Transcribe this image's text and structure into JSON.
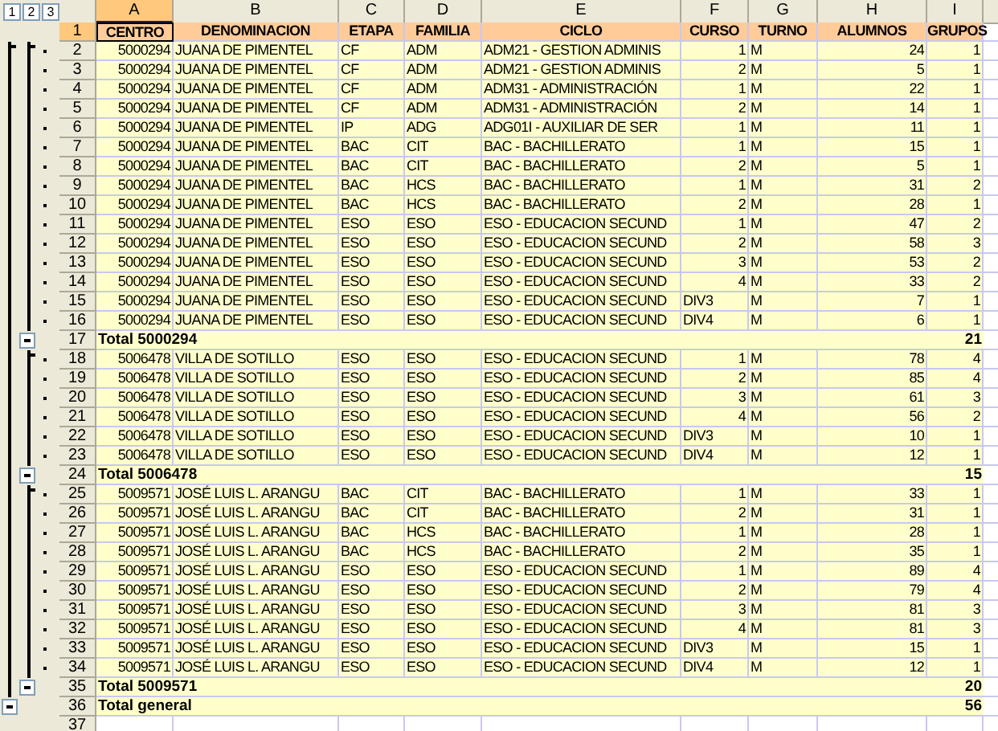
{
  "outline_levels": [
    "1",
    "2",
    "3"
  ],
  "columns": [
    {
      "letter": "A",
      "selected": true
    },
    {
      "letter": "B",
      "selected": false
    },
    {
      "letter": "C",
      "selected": false
    },
    {
      "letter": "D",
      "selected": false
    },
    {
      "letter": "E",
      "selected": false
    },
    {
      "letter": "F",
      "selected": false
    },
    {
      "letter": "G",
      "selected": false
    },
    {
      "letter": "H",
      "selected": false
    },
    {
      "letter": "I",
      "selected": false
    }
  ],
  "rows": [
    {
      "num": "1",
      "kind": "header",
      "selected": true,
      "cells": [
        "CENTRO",
        "DENOMINACION",
        "ETAPA",
        "FAMILIA",
        "CICLO",
        "CURSO",
        "TURNO",
        "ALUMNOS",
        "GRUPOS"
      ]
    },
    {
      "num": "2",
      "kind": "detail",
      "selected": false,
      "cells": [
        "5000294",
        "JUANA DE PIMENTEL",
        "CF",
        "ADM",
        "ADM21 - GESTION ADMINIS",
        "1",
        "M",
        "24",
        "1"
      ]
    },
    {
      "num": "3",
      "kind": "detail",
      "selected": false,
      "cells": [
        "5000294",
        "JUANA DE PIMENTEL",
        "CF",
        "ADM",
        "ADM21 - GESTION ADMINIS",
        "2",
        "M",
        "5",
        "1"
      ]
    },
    {
      "num": "4",
      "kind": "detail",
      "selected": false,
      "cells": [
        "5000294",
        "JUANA DE PIMENTEL",
        "CF",
        "ADM",
        "ADM31 - ADMINISTRACIÓN",
        "1",
        "M",
        "22",
        "1"
      ]
    },
    {
      "num": "5",
      "kind": "detail",
      "selected": false,
      "cells": [
        "5000294",
        "JUANA DE PIMENTEL",
        "CF",
        "ADM",
        "ADM31 - ADMINISTRACIÓN",
        "2",
        "M",
        "14",
        "1"
      ]
    },
    {
      "num": "6",
      "kind": "detail",
      "selected": false,
      "cells": [
        "5000294",
        "JUANA DE PIMENTEL",
        "IP",
        "ADG",
        "ADG01I - AUXILIAR DE SER",
        "1",
        "M",
        "11",
        "1"
      ]
    },
    {
      "num": "7",
      "kind": "detail",
      "selected": false,
      "cells": [
        "5000294",
        "JUANA DE PIMENTEL",
        "BAC",
        "CIT",
        "BAC - BACHILLERATO",
        "1",
        "M",
        "15",
        "1"
      ]
    },
    {
      "num": "8",
      "kind": "detail",
      "selected": false,
      "cells": [
        "5000294",
        "JUANA DE PIMENTEL",
        "BAC",
        "CIT",
        "BAC - BACHILLERATO",
        "2",
        "M",
        "5",
        "1"
      ]
    },
    {
      "num": "9",
      "kind": "detail",
      "selected": false,
      "cells": [
        "5000294",
        "JUANA DE PIMENTEL",
        "BAC",
        "HCS",
        "BAC - BACHILLERATO",
        "1",
        "M",
        "31",
        "2"
      ]
    },
    {
      "num": "10",
      "kind": "detail",
      "selected": false,
      "cells": [
        "5000294",
        "JUANA DE PIMENTEL",
        "BAC",
        "HCS",
        "BAC - BACHILLERATO",
        "2",
        "M",
        "28",
        "1"
      ]
    },
    {
      "num": "11",
      "kind": "detail",
      "selected": false,
      "cells": [
        "5000294",
        "JUANA DE PIMENTEL",
        "ESO",
        "ESO",
        "ESO - EDUCACION SECUND",
        "1",
        "M",
        "47",
        "2"
      ]
    },
    {
      "num": "12",
      "kind": "detail",
      "selected": false,
      "cells": [
        "5000294",
        "JUANA DE PIMENTEL",
        "ESO",
        "ESO",
        "ESO - EDUCACION SECUND",
        "2",
        "M",
        "58",
        "3"
      ]
    },
    {
      "num": "13",
      "kind": "detail",
      "selected": false,
      "cells": [
        "5000294",
        "JUANA DE PIMENTEL",
        "ESO",
        "ESO",
        "ESO - EDUCACION SECUND",
        "3",
        "M",
        "53",
        "2"
      ]
    },
    {
      "num": "14",
      "kind": "detail",
      "selected": false,
      "cells": [
        "5000294",
        "JUANA DE PIMENTEL",
        "ESO",
        "ESO",
        "ESO - EDUCACION SECUND",
        "4",
        "M",
        "33",
        "2"
      ]
    },
    {
      "num": "15",
      "kind": "detail",
      "selected": false,
      "cells": [
        "5000294",
        "JUANA DE PIMENTEL",
        "ESO",
        "ESO",
        "ESO - EDUCACION SECUND",
        "DIV3",
        "M",
        "7",
        "1"
      ]
    },
    {
      "num": "16",
      "kind": "detail",
      "selected": false,
      "cells": [
        "5000294",
        "JUANA DE PIMENTEL",
        "ESO",
        "ESO",
        "ESO - EDUCACION SECUND",
        "DIV4",
        "M",
        "6",
        "1"
      ]
    },
    {
      "num": "17",
      "kind": "subtotal",
      "selected": false,
      "label": "Total 5000294",
      "total": "21"
    },
    {
      "num": "18",
      "kind": "detail",
      "selected": false,
      "cells": [
        "5006478",
        "VILLA DE SOTILLO",
        "ESO",
        "ESO",
        "ESO - EDUCACION SECUND",
        "1",
        "M",
        "78",
        "4"
      ]
    },
    {
      "num": "19",
      "kind": "detail",
      "selected": false,
      "cells": [
        "5006478",
        "VILLA DE SOTILLO",
        "ESO",
        "ESO",
        "ESO - EDUCACION SECUND",
        "2",
        "M",
        "85",
        "4"
      ]
    },
    {
      "num": "20",
      "kind": "detail",
      "selected": false,
      "cells": [
        "5006478",
        "VILLA DE SOTILLO",
        "ESO",
        "ESO",
        "ESO - EDUCACION SECUND",
        "3",
        "M",
        "61",
        "3"
      ]
    },
    {
      "num": "21",
      "kind": "detail",
      "selected": false,
      "cells": [
        "5006478",
        "VILLA DE SOTILLO",
        "ESO",
        "ESO",
        "ESO - EDUCACION SECUND",
        "4",
        "M",
        "56",
        "2"
      ]
    },
    {
      "num": "22",
      "kind": "detail",
      "selected": false,
      "cells": [
        "5006478",
        "VILLA DE SOTILLO",
        "ESO",
        "ESO",
        "ESO - EDUCACION SECUND",
        "DIV3",
        "M",
        "10",
        "1"
      ]
    },
    {
      "num": "23",
      "kind": "detail",
      "selected": false,
      "cells": [
        "5006478",
        "VILLA DE SOTILLO",
        "ESO",
        "ESO",
        "ESO - EDUCACION SECUND",
        "DIV4",
        "M",
        "12",
        "1"
      ]
    },
    {
      "num": "24",
      "kind": "subtotal",
      "selected": false,
      "label": "Total 5006478",
      "total": "15"
    },
    {
      "num": "25",
      "kind": "detail",
      "selected": false,
      "cells": [
        "5009571",
        "JOSÉ LUIS L. ARANGU",
        "BAC",
        "CIT",
        "BAC - BACHILLERATO",
        "1",
        "M",
        "33",
        "1"
      ]
    },
    {
      "num": "26",
      "kind": "detail",
      "selected": false,
      "cells": [
        "5009571",
        "JOSÉ LUIS L. ARANGU",
        "BAC",
        "CIT",
        "BAC - BACHILLERATO",
        "2",
        "M",
        "31",
        "1"
      ]
    },
    {
      "num": "27",
      "kind": "detail",
      "selected": false,
      "cells": [
        "5009571",
        "JOSÉ LUIS L. ARANGU",
        "BAC",
        "HCS",
        "BAC - BACHILLERATO",
        "1",
        "M",
        "28",
        "1"
      ]
    },
    {
      "num": "28",
      "kind": "detail",
      "selected": false,
      "cells": [
        "5009571",
        "JOSÉ LUIS L. ARANGU",
        "BAC",
        "HCS",
        "BAC - BACHILLERATO",
        "2",
        "M",
        "35",
        "1"
      ]
    },
    {
      "num": "29",
      "kind": "detail",
      "selected": false,
      "cells": [
        "5009571",
        "JOSÉ LUIS L. ARANGU",
        "ESO",
        "ESO",
        "ESO - EDUCACION SECUND",
        "1",
        "M",
        "89",
        "4"
      ]
    },
    {
      "num": "30",
      "kind": "detail",
      "selected": false,
      "cells": [
        "5009571",
        "JOSÉ LUIS L. ARANGU",
        "ESO",
        "ESO",
        "ESO - EDUCACION SECUND",
        "2",
        "M",
        "79",
        "4"
      ]
    },
    {
      "num": "31",
      "kind": "detail",
      "selected": false,
      "cells": [
        "5009571",
        "JOSÉ LUIS L. ARANGU",
        "ESO",
        "ESO",
        "ESO - EDUCACION SECUND",
        "3",
        "M",
        "81",
        "3"
      ]
    },
    {
      "num": "32",
      "kind": "detail",
      "selected": false,
      "cells": [
        "5009571",
        "JOSÉ LUIS L. ARANGU",
        "ESO",
        "ESO",
        "ESO - EDUCACION SECUND",
        "4",
        "M",
        "81",
        "3"
      ]
    },
    {
      "num": "33",
      "kind": "detail",
      "selected": false,
      "cells": [
        "5009571",
        "JOSÉ LUIS L. ARANGU",
        "ESO",
        "ESO",
        "ESO - EDUCACION SECUND",
        "DIV3",
        "M",
        "15",
        "1"
      ]
    },
    {
      "num": "34",
      "kind": "detail",
      "selected": false,
      "cells": [
        "5009571",
        "JOSÉ LUIS L. ARANGU",
        "ESO",
        "ESO",
        "ESO - EDUCACION SECUND",
        "DIV4",
        "M",
        "12",
        "1"
      ]
    },
    {
      "num": "35",
      "kind": "subtotal",
      "selected": false,
      "label": "Total 5009571",
      "total": "20"
    },
    {
      "num": "36",
      "kind": "grandtotal",
      "selected": false,
      "label": "Total general",
      "total": "56"
    },
    {
      "num": "37",
      "kind": "empty",
      "selected": false
    }
  ]
}
